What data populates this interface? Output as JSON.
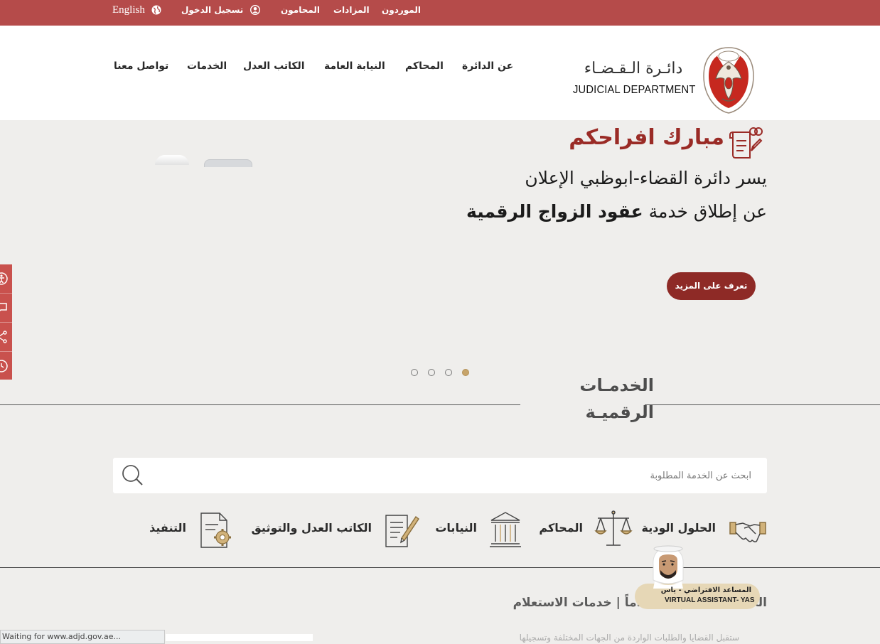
{
  "topbar": {
    "language": "English",
    "login": "تسجيل الدخول",
    "lawyers": "المحامون",
    "auctions": "المزادات",
    "suppliers": "الموردون"
  },
  "header": {
    "logo_ar": "دائـرة الـقـضـاء",
    "logo_en": "JUDICIAL DEPARTMENT",
    "nav": [
      "عن الدائرة",
      "المحاكم",
      "النيابة العامة",
      "الكاتب العدل",
      "الخدمات",
      "تواصل معنا"
    ]
  },
  "hero": {
    "title": "مبارك افراحكم",
    "line1": "يسر دائرة القضاء-ابوظبي الإعلان",
    "line2_prefix": "عن إطلاق خدمة ",
    "line2_bold": "عقود الزواج الرقمية",
    "button": "تعرف على المزيد",
    "slides_total": 4,
    "active_slide": 1
  },
  "services": {
    "title_line1": "الخدمـات",
    "title_line2": "الرقميـة",
    "search_placeholder": "ابحث عن الخدمة المطلوبة",
    "categories": [
      {
        "label": "الحلول الودية",
        "icon": "handshake-icon"
      },
      {
        "label": "المحاكم",
        "icon": "scales-icon"
      },
      {
        "label": "النيابات",
        "icon": "courthouse-icon"
      },
      {
        "label": "الكاتب العدل والتوثيق",
        "icon": "document-pen-icon"
      },
      {
        "label": "التنفيذ",
        "icon": "document-gear-icon"
      }
    ]
  },
  "inquiry": {
    "title": "الخدمات الأكثر استخداماً | خدمات الاستعلام",
    "faint_text": "ستقبل القضايا والطلبات الواردة من الجهات المختلفة وتسجيلها"
  },
  "assistant": {
    "label_ar": "المساعد الافتراضي - ياس",
    "label_en": "VIRTUAL ASSISTANT- YAS"
  },
  "status": {
    "text": "Waiting for www.adjd.gov.ae..."
  },
  "colors": {
    "topbar": "#b54b4a",
    "brand_dark": "#8e2a26",
    "gold": "#c7a46a",
    "background": "#efeeec"
  }
}
